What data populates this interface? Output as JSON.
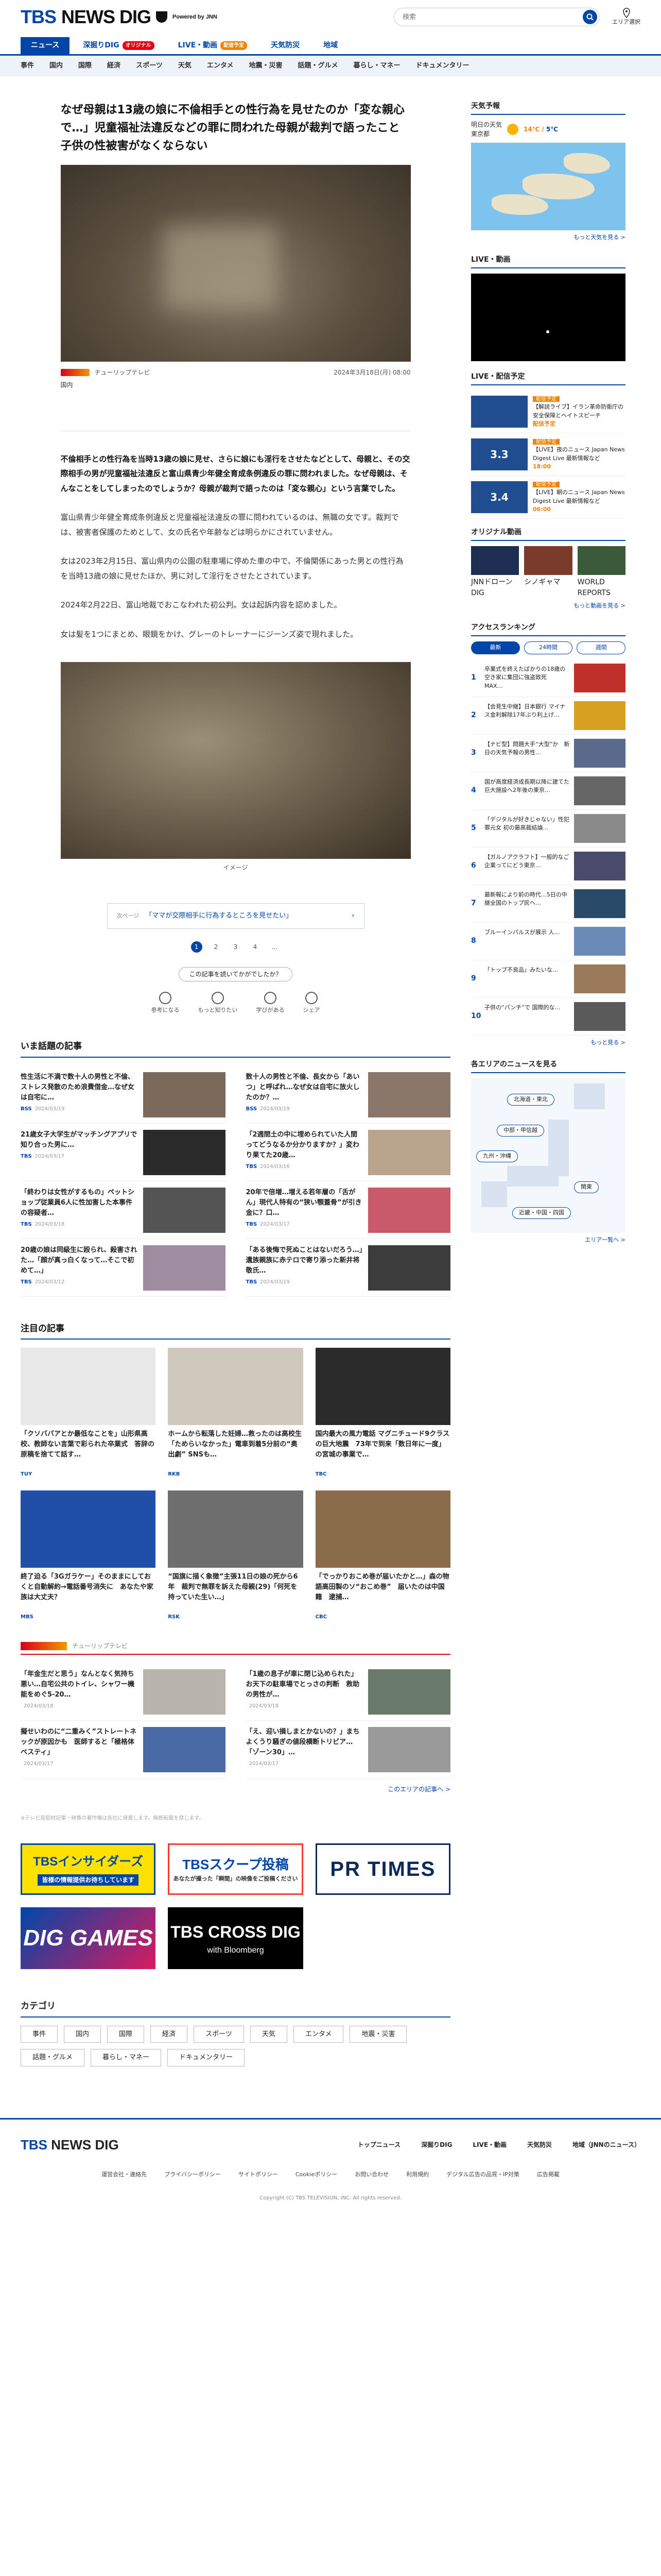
{
  "header": {
    "logo_tbs": "TBS",
    "logo_news": "NEWS DIG",
    "powered": "Powered by JNN",
    "search_placeholder": "検索",
    "area_label": "エリア選択"
  },
  "nav_main": [
    {
      "label": "ニュース",
      "badge": ""
    },
    {
      "label": "深掘りDIG",
      "badge": "オリジナル"
    },
    {
      "label": "LIVE・動画",
      "badge": "配信予定"
    },
    {
      "label": "天気防災",
      "badge": ""
    },
    {
      "label": "地域",
      "badge": ""
    }
  ],
  "nav_sub": [
    "事件",
    "国内",
    "国際",
    "経済",
    "スポーツ",
    "天気",
    "エンタメ",
    "地震・災害",
    "話題・グルメ",
    "暮らし・マネー",
    "ドキュメンタリー"
  ],
  "article": {
    "title": "なぜ母親は13歳の娘に不倫相手との性行為を見せたのか「変な親心で…」児童福祉法違反などの罪に問われた母親が裁判で語ったこと　子供の性被害がなくならない",
    "source": "チューリップテレビ",
    "date": "2024年3月18日(月) 08:00",
    "tag": "国内",
    "lead": "不倫相手との性行為を当時13歳の娘に見せ、さらに娘にも淫行をさせたなどとして、母親と、その交際相手の男が児童福祉法違反と富山県青少年健全育成条例違反の罪に問われました。なぜ母親は、そんなことをしてしまったのでしょうか？母親が裁判で語ったのは「変な親心」という言葉でした。",
    "paragraphs": [
      "富山県青少年健全育成条例違反と児童福祉法違反の罪に問われているのは、無職の女です。裁判では、被害者保護のためとして、女の氏名や年齢などは明らかにされていません。",
      "女は2023年2月15日、富山県内の公園の駐車場に停めた車の中で、不倫関係にあった男との性行為を当時13歳の娘に見せたほか、男に対して淫行をさせたとされています。",
      "2024年2月22日、富山地裁でおこなわれた初公判。女は起訴内容を認めました。",
      "女は髪を1つにまとめ、眼鏡をかけ、グレーのトレーナーにジーンズ姿で現れました。"
    ],
    "image_caption": "イメージ",
    "next_label": "次ページ",
    "next_text": "「ママが交際相手に行為するところを見せたい」",
    "pages": [
      "1",
      "2",
      "3",
      "4",
      "…"
    ],
    "reaction_q": "この記事を読いてかがでしたか？",
    "reactions": [
      "参考になる",
      "もっと知りたい",
      "学びがある",
      "シェア"
    ]
  },
  "trending": {
    "title": "いま話題の記事",
    "items": [
      {
        "text": "性生活に不満で数十人の男性と不倫、ストレス発散のため浪費借金…なぜ女は自宅に…",
        "src": "BSS",
        "date": "2024/03/19"
      },
      {
        "text": "数十人の男性と不倫、長女から「あいつ」と呼ばれ…なぜ女は自宅に放火したのか？…",
        "src": "BSS",
        "date": "2024/03/19"
      },
      {
        "text": "21歳女子大学生がマッチングアプリで知り合った男に…",
        "src": "TBS",
        "date": "2024/03/17"
      },
      {
        "text": "「2週間土の中に埋められていた人間ってどうなるか分かりますか？」変わり果てた20歳…",
        "src": "TBS",
        "date": "2024/03/16"
      },
      {
        "text": "「終わりは女性がするもの」ペットショップ従業員6人に性加害した本事件の容疑者…",
        "src": "TBS",
        "date": "2024/03/18"
      },
      {
        "text": "20年で倍増…増える若年層の「舌がん」現代人特有の“狭い顎蓋骨”が引き金に？口…",
        "src": "TBS",
        "date": "2024/03/17"
      },
      {
        "text": "20歳の娘は同級生に殴られ、殺害された…「顔が真っ白くなって…そこで初めて…」",
        "src": "TBS",
        "date": "2024/03/12"
      },
      {
        "text": "「ある後悔で死ぬことはないだろう…」遺族親族に赤テロで寄り添った新井将敬氏…",
        "src": "TBS",
        "date": "2024/03/19"
      }
    ]
  },
  "featured": {
    "title": "注目の記事",
    "items": [
      {
        "text": "「クソババアとか最低なことを」山形県高校、教師ない言葉で彩られた卒業式　答辞の原稿を捨てて話す…",
        "src": "TUY",
        "date": "2024/03/18"
      },
      {
        "text": "ホームから転落した妊婦…救ったのは高校生「ためらいなかった」電車到着5分前の“奥出劇” SNSも…",
        "src": "RKB",
        "date": "2024/03/18"
      },
      {
        "text": "国内最大の風力電話 マグニチュード9クラスの巨大地震　73年で到来「数日年に一度」の宮城の事業で…",
        "src": "TBC",
        "date": "2024/03/18"
      },
      {
        "text": "終了迫る「3Gガラケー」そのままにしておくと自動解約→電話番号消失に　あなたや家族は大丈夫？",
        "src": "MBS",
        "date": "2024/03/18"
      },
      {
        "text": "“国旗に描く象徴”主張11日の娘の死から6年　裁判で無罪を訴えた母親(29)「何死を持っていた生い…」",
        "src": "RSK",
        "date": "2024/03/18"
      },
      {
        "text": "「でっかりおこめ巻が届いたかと…」森の物語高田製のソ“おこめ巻”　届いたのは中国籍　逮捕…",
        "src": "CBC",
        "date": "2024/03/17"
      }
    ]
  },
  "crosspost": {
    "source": "チューリップテレビ",
    "items": [
      {
        "text": "「年金生だと思う」なんとなく気持ち悪い…自宅公共のトイレ、シャワー機能をめぐ5-20…",
        "src": "",
        "date": "2024/03/18"
      },
      {
        "text": "「1歳の息子が車に閉じ込められた」お天下の駐車場でとっさの判断　救助の男性が…",
        "src": "",
        "date": "2024/03/18"
      },
      {
        "text": "擬せいわのに“二重みく”ストレートネックが原因かも　医師すると「極格体ベスティ」",
        "src": "",
        "date": "2024/03/17"
      },
      {
        "text": "「え、迎い損しまとかないの？」まちよくうり騒ぎの値段横断トリビア…「ゾーン30」…",
        "src": "",
        "date": "2024/03/17"
      }
    ],
    "more": "このエリアの記事へ >"
  },
  "footnote": "※テレビ局取材記事・映像の著作権は各社に帰属します。無断転載を禁じます。",
  "banners": {
    "insiders": "TBSインサイダーズ",
    "insiders_sub": "皆様の情報提供お待ちしています",
    "scoop": "TBSスクープ投稿",
    "scoop_sub": "あなたが撮った「瞬間」の映像をご投稿ください",
    "prtimes": "PR TIMES",
    "dig": "DIG GAMES",
    "cross": "TBS CROSS DIG",
    "cross_sub": "with Bloomberg"
  },
  "categories": {
    "title": "カテゴリ",
    "items": [
      "事件",
      "国内",
      "国際",
      "経済",
      "スポーツ",
      "天気",
      "エンタメ",
      "地震・災害",
      "話題・グルメ",
      "暮らし・マネー",
      "ドキュメンタリー"
    ]
  },
  "sidebar": {
    "weather_title": "天気予報",
    "weather_place": "明日の天気\n東京都",
    "weather_hi": "14℃",
    "weather_lo": "5℃",
    "weather_more": "もっと天気を見る >",
    "live_title": "LIVE・動画",
    "sched_title": "LIVE・配信予定",
    "schedule": [
      {
        "label": "配信予定",
        "thumb": "",
        "text": "【解説ライブ】イラン革命防衛庁の安全保障とヘイトスピーチ",
        "time": "配信予定"
      },
      {
        "label": "配信予定",
        "thumb": "3.3",
        "text": "【LIVE】夜のニュース Japan News Digest Live 最新情報など",
        "time": "18:00"
      },
      {
        "label": "配信予定",
        "thumb": "3.4",
        "text": "【LIVE】朝のニュース Japan News Digest Live 最新情報など",
        "time": "06:00"
      }
    ],
    "orig_title": "オリジナル動画",
    "originals": [
      "JNNドローンDIG",
      "シノギャマ",
      "WORLD REPORTS"
    ],
    "orig_more": "もっと動画を見る >",
    "rank_title": "アクセスランキング",
    "rank_tabs": [
      "最新",
      "24時間",
      "週間"
    ],
    "ranking": [
      "卒業式を終えたばかりの18歳の空き家に集団に強盗致死　MAX…",
      "【会見生中継】日本銀行 マイナス金利解除17年ぶり利上げ…",
      "【ナビ型】問題大手“大型”か　新日の天気予報の男性…",
      "国が高度経済成長期以降に建てた巨大施設へ2年後の東京…",
      "「デジタルが好きじゃない」性犯罪元女 初の最高裁結論…",
      "【ガルノアクラフト】一般的なご企業ってにどう東京…",
      "最新報により前の時代…5日の中継全国のトップ民へ…",
      "ブルーインパルスが展示 人…",
      "「トップ不良品」みたいな…",
      "子供の“パンチ”で 国際的な…"
    ],
    "rank_more": "もっと見る >",
    "region_title": "各エリアのニュースを見る",
    "regions": [
      "北海道・東北",
      "中部・甲信越",
      "九州・沖縄",
      "関東",
      "近畿・中国・四国"
    ],
    "region_more": "エリア一覧へ >"
  },
  "footer": {
    "nav": [
      "トップニュース",
      "深掘りDIG",
      "LIVE・動画",
      "天気防災",
      "地域（JNNのニュース）"
    ],
    "links": [
      "運営会社・連絡先",
      "プライバシーポリシー",
      "サイトポリシー",
      "Cookieポリシー",
      "お問い合わせ",
      "利用規約",
      "デジタル広告の品質・IP対策",
      "広告掲載"
    ],
    "copy": "Copyright (C) TBS TELEVISION, INC. All rights reserved."
  }
}
